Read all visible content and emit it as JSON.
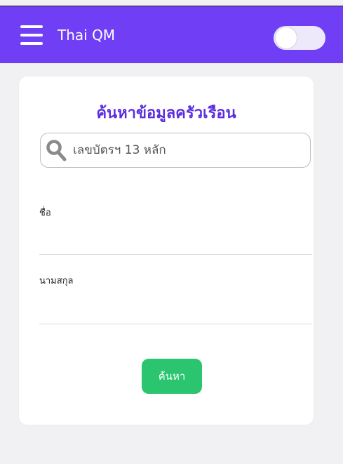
{
  "header": {
    "app_title": "Thai QM",
    "menu_icon": "hamburger-menu-icon",
    "toggle_state": "off"
  },
  "form": {
    "title": "ค้นหาข้อมูลครัวเรือน",
    "search": {
      "icon": "search-icon",
      "placeholder": "เลขบัตรฯ 13 หลัก",
      "value": ""
    },
    "first_name": {
      "label": "ชื่อ",
      "value": ""
    },
    "last_name": {
      "label": "นามสกุล",
      "value": ""
    },
    "submit_label": "ค้นหา"
  },
  "colors": {
    "header_bg": "#6f3ef5",
    "title": "#5a2ee0",
    "button_bg": "#2bc46f",
    "page_bg": "#f1f1f3"
  }
}
